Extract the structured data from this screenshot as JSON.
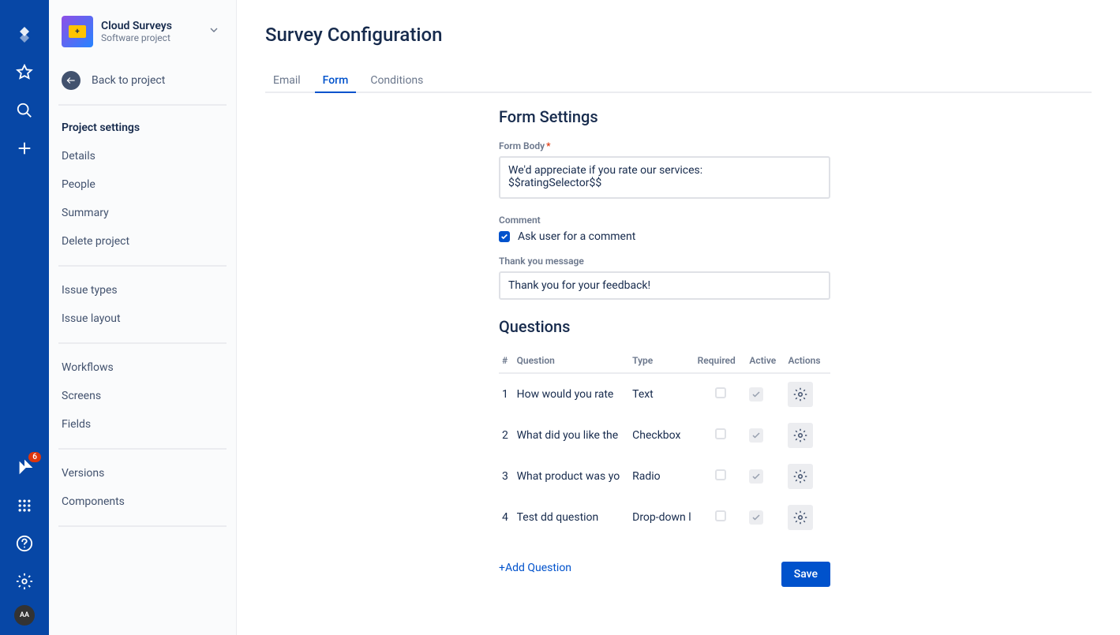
{
  "leftnav": {
    "notification_count": "6",
    "avatar_initials": "AA"
  },
  "project": {
    "name": "Cloud Surveys",
    "type": "Software project"
  },
  "sidebar": {
    "back_label": "Back to project",
    "section_title": "Project settings",
    "items_a": [
      "Details",
      "People",
      "Summary",
      "Delete project"
    ],
    "items_b": [
      "Issue types",
      "Issue layout"
    ],
    "items_c": [
      "Workflows",
      "Screens",
      "Fields"
    ],
    "items_d": [
      "Versions",
      "Components"
    ]
  },
  "page": {
    "title": "Survey Configuration",
    "tabs": [
      "Email",
      "Form",
      "Conditions"
    ],
    "active_tab": 1
  },
  "form_settings": {
    "heading": "Form Settings",
    "body_label": "Form Body",
    "body_value": "We'd appreciate if you rate our services:\n$$ratingSelector$$",
    "comment_label": "Comment",
    "comment_checkbox_label": "Ask user for a comment",
    "thankyou_label": "Thank you message",
    "thankyou_value": "Thank you for your feedback!"
  },
  "questions": {
    "heading": "Questions",
    "columns": [
      "#",
      "Question",
      "Type",
      "Required",
      "Active",
      "Actions"
    ],
    "rows": [
      {
        "num": "1",
        "q": "How would you rate",
        "type": "Text",
        "required": false,
        "active": true
      },
      {
        "num": "2",
        "q": "What did you like the",
        "type": "Checkbox",
        "required": false,
        "active": true
      },
      {
        "num": "3",
        "q": "What product was yo",
        "type": "Radio",
        "required": false,
        "active": true
      },
      {
        "num": "4",
        "q": "Test dd question",
        "type": "Drop-down l",
        "required": false,
        "active": true
      }
    ],
    "add_label": "+Add Question",
    "save_label": "Save"
  }
}
